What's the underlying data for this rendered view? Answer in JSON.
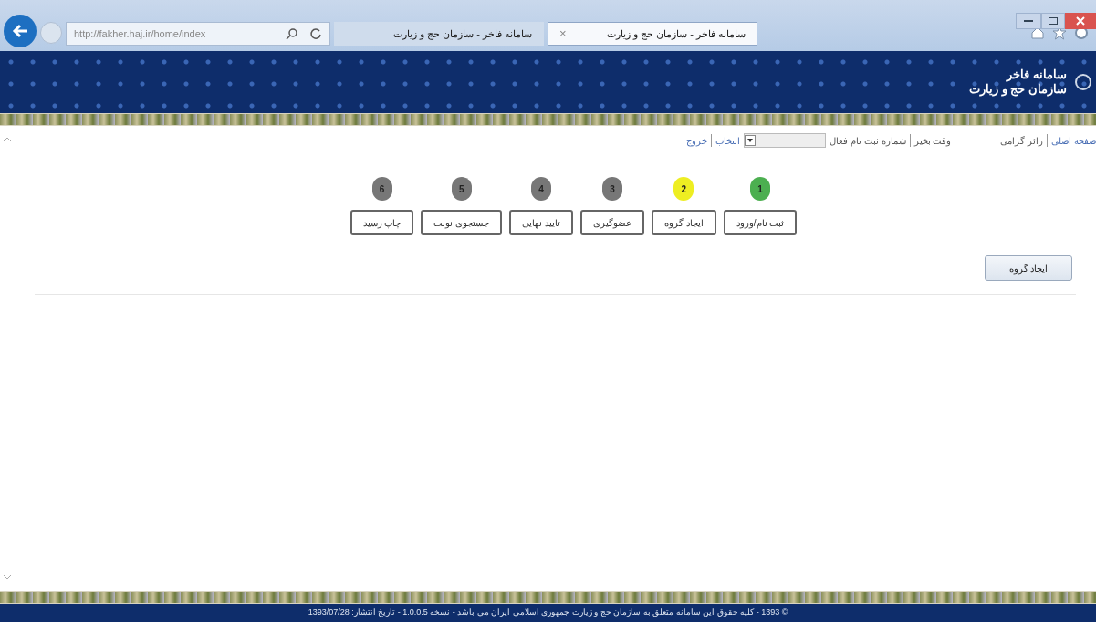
{
  "browser": {
    "address": "http://fakher.haj.ir/home/index",
    "tabs": [
      {
        "label": "سامانه فاخر - سازمان حج و زیارت",
        "selected": true
      },
      {
        "label": "سامانه فاخر - سازمان حج و زیارت",
        "selected": false
      }
    ],
    "close_tab": "×"
  },
  "header": {
    "title": "سامانه فاخر",
    "subtitle": "سازمان حج و زیارت"
  },
  "nav": {
    "home": "صفحه اصلی",
    "greeting_prefix": "زائر گرامی",
    "greeting_suffix": "وقت بخیر",
    "registration_label": "شماره ثبت نام فعال",
    "select_button": "انتخاب",
    "logout": "خروج"
  },
  "steps": [
    {
      "number": "1",
      "label": "ثبت نام/ورود",
      "color": "#4caf50"
    },
    {
      "number": "2",
      "label": "ایجاد گروه",
      "color": "#eeee22"
    },
    {
      "number": "3",
      "label": "عضوگیری",
      "color": "#777777"
    },
    {
      "number": "4",
      "label": "تایید نهایی",
      "color": "#777777"
    },
    {
      "number": "5",
      "label": "جستجوی نوبت",
      "color": "#777777"
    },
    {
      "number": "6",
      "label": "چاپ رسید",
      "color": "#777777"
    }
  ],
  "action_button": "ایجاد گروه",
  "footer": "© 1393 - کلیه حقوق این سامانه متعلق به سازمان حج و زیارت جمهوری اسلامی ایران می باشد - نسخه 1.0.0.5 - تاریخ انتشار: 1393/07/28"
}
